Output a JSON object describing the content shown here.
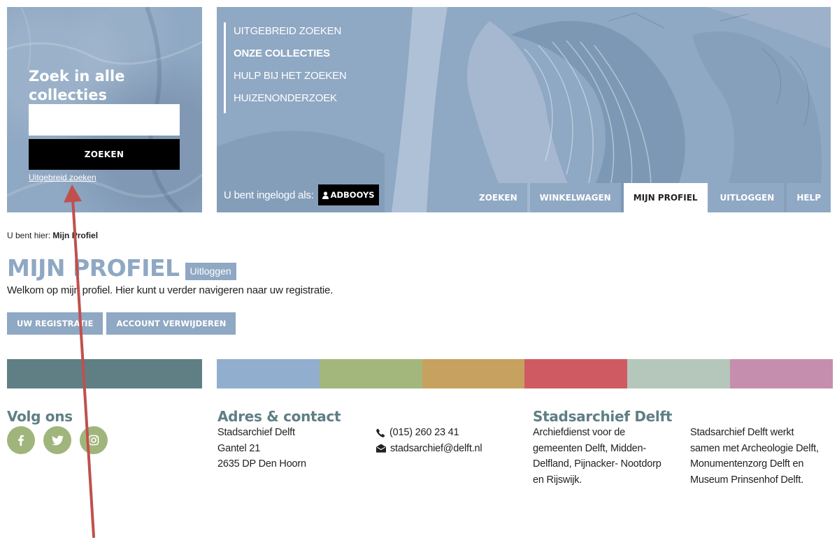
{
  "search": {
    "title": "Zoek in alle collecties",
    "input_value": "",
    "button_label": "ZOEKEN",
    "advanced_link": "Uitgebreid zoeken"
  },
  "banner": {
    "nav": [
      {
        "label": "UITGEBREID ZOEKEN",
        "active": false
      },
      {
        "label": "ONZE COLLECTIES",
        "active": true
      },
      {
        "label": "HULP BIJ HET ZOEKEN",
        "active": false
      },
      {
        "label": "HUIZENONDERZOEK",
        "active": false
      }
    ],
    "login_text": "U bent ingelogd als:",
    "username": "ADBOOYS",
    "user_icon": "user-icon",
    "tabs": [
      {
        "label": "ZOEKEN",
        "active": false
      },
      {
        "label": "WINKELWAGEN",
        "active": false
      },
      {
        "label": "MIJN PROFIEL",
        "active": true
      },
      {
        "label": "UITLOGGEN",
        "active": false
      },
      {
        "label": "HELP",
        "active": false
      }
    ]
  },
  "breadcrumb": {
    "prefix": "U bent hier:",
    "current": "Mijn Profiel"
  },
  "page": {
    "title": "MIJN PROFIEL",
    "logout_label": "Uitloggen",
    "welcome": "Welkom op mijn profiel. Hier kunt u verder navigeren naar uw registratie.",
    "actions": [
      "UW REGISTRATIE",
      "ACCOUNT VERWIJDEREN"
    ]
  },
  "colors": {
    "accent_blue": "#8fa8c3",
    "teal": "#5f7f84",
    "strip": [
      "#92aece",
      "#a3b77c",
      "#c6a15f",
      "#d05a62",
      "#b5c7bb",
      "#c68eae"
    ]
  },
  "footer": {
    "follow": {
      "title": "Volg ons",
      "icons": [
        "facebook-icon",
        "twitter-icon",
        "instagram-icon"
      ]
    },
    "address": {
      "title": "Adres & contact",
      "lines": [
        "Stadsarchief Delft",
        "Gantel 21",
        "2635 DP Den Hoorn"
      ]
    },
    "contact": {
      "phone": "(015) 260 23 41",
      "email": "stadsarchief@delft.nl"
    },
    "about": {
      "title": "Stadsarchief Delft",
      "lines": [
        "Archiefdienst voor de",
        "gemeenten Delft, Midden-",
        "Delfland, Pijnacker- Nootdorp",
        "en Rijswijk."
      ]
    },
    "partners": {
      "lines": [
        "Stadsarchief Delft werkt",
        "samen met Archeologie Delft,",
        "Monumentenzorg Delft en",
        "Museum Prinsenhof Delft."
      ]
    }
  },
  "annotation": {
    "arrow_color": "#c0504d"
  }
}
